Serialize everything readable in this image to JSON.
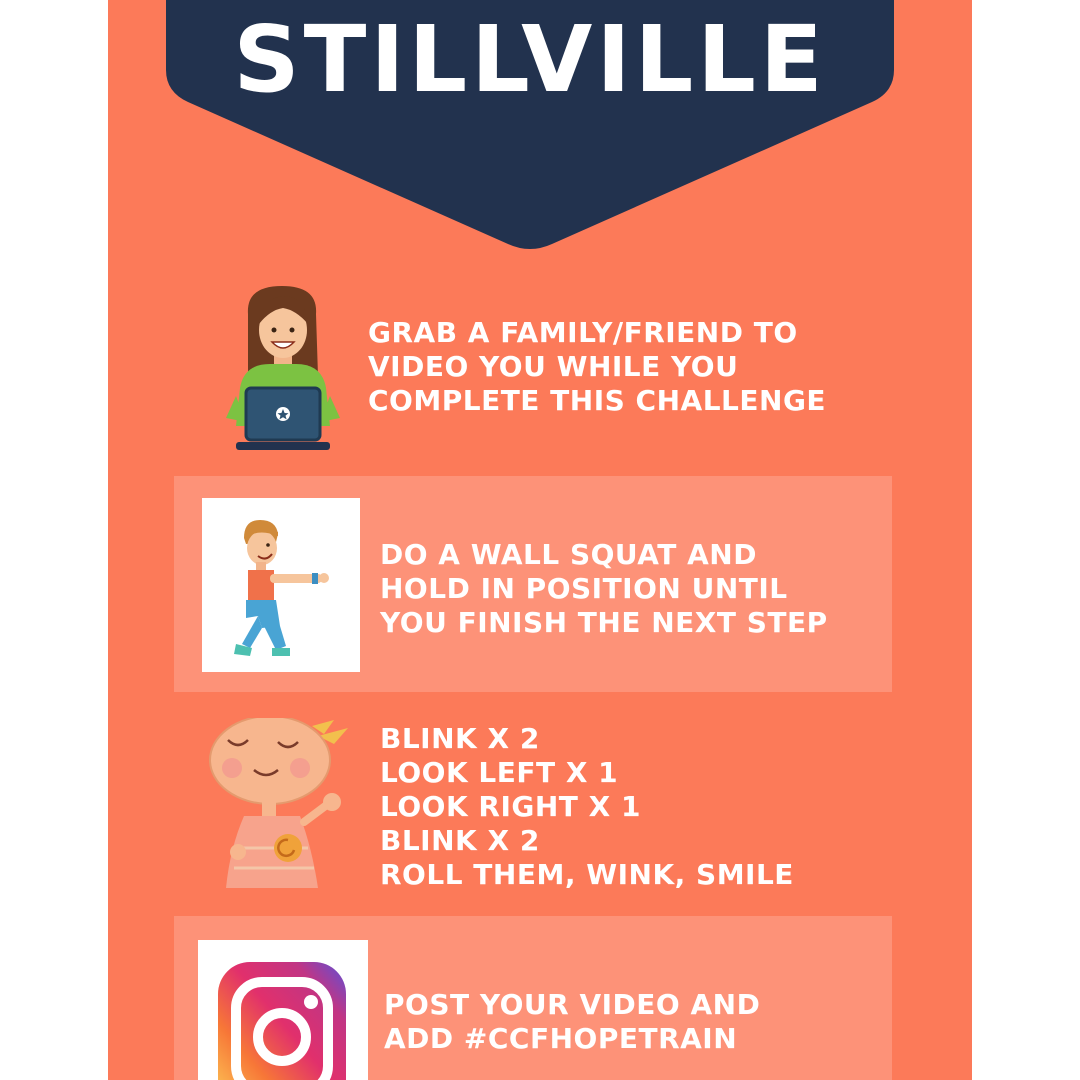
{
  "title": "STILLVILLE",
  "colors": {
    "background": "#fc7a59",
    "banner": "#22324e",
    "card": "#fd9278",
    "text": "#ffffff"
  },
  "steps": [
    {
      "icon": "woman-laptop-icon",
      "lines": [
        "GRAB A FAMILY/FRIEND TO",
        "VIDEO YOU WHILE YOU",
        "COMPLETE THIS CHALLENGE"
      ]
    },
    {
      "icon": "wall-squat-icon",
      "lines": [
        "DO A WALL SQUAT AND",
        "HOLD IN POSITION UNTIL",
        "YOU FINISH THE NEXT STEP"
      ]
    },
    {
      "icon": "smiling-girl-icon",
      "lines": [
        "BLINK X 2",
        "LOOK LEFT X 1",
        "LOOK RIGHT X 1",
        "BLINK X 2",
        "ROLL THEM, WINK, SMILE"
      ]
    },
    {
      "icon": "instagram-icon",
      "lines": [
        "POST YOUR VIDEO AND",
        "ADD #CCFHOPETRAIN"
      ]
    }
  ]
}
